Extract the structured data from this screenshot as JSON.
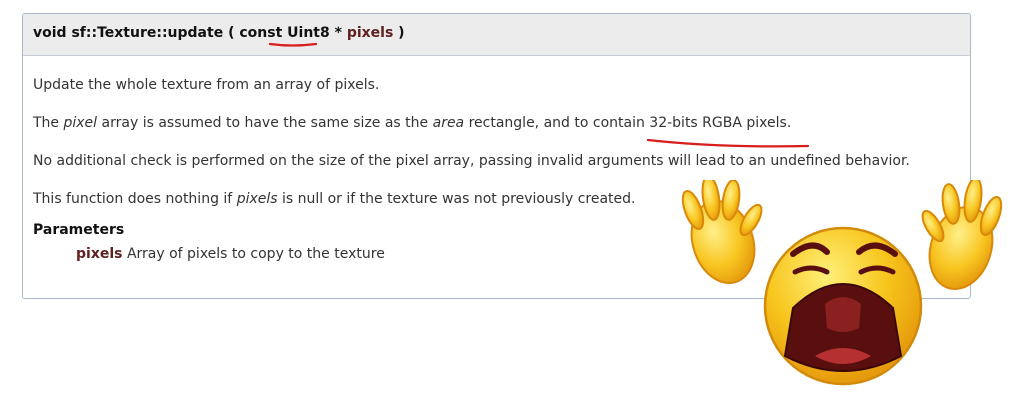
{
  "prototype": {
    "return_type": "void",
    "name": "sf::Texture::update",
    "open_paren": "(",
    "qualifier": "const",
    "param_type": "Uint8",
    "pointer": "*",
    "param_name": "pixels",
    "close_paren": ")"
  },
  "description": {
    "line1": "Update the whole texture from an array of pixels.",
    "line2": {
      "part1": "The ",
      "em1": "pixel",
      "part2": " array is assumed to have the same size as the ",
      "em2": "area",
      "part3": " rectangle, and to contain ",
      "highlight": "32-bits RGBA pixels",
      "part4": "."
    },
    "line3": "No additional check is performed on the size of the pixel array, passing invalid arguments will lead to an undefined behavior.",
    "line4": {
      "part1": "This function does nothing if ",
      "em1": "pixels",
      "part2": " is null or if the texture was not previously created."
    }
  },
  "parameters": {
    "heading": "Parameters",
    "items": [
      {
        "name": "pixels",
        "description": "Array of pixels to copy to the texture"
      }
    ]
  },
  "colors": {
    "annotation": "#d91d1d",
    "param_name": "#602020",
    "border": "#a9b6cc",
    "header_bg": "#ececec",
    "emoji_face": "#f7c51c",
    "emoji_mouth": "#5a0f0f"
  },
  "overlay": {
    "emoji_icon": "crying-face-emoji-icon"
  }
}
